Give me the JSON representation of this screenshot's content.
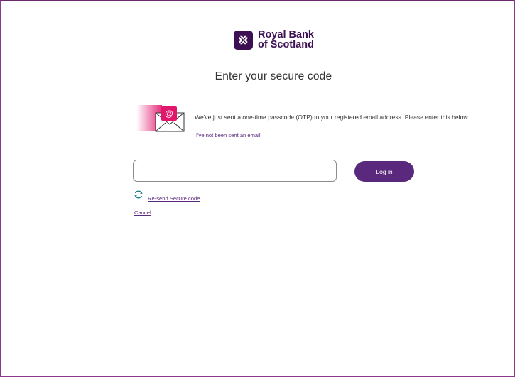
{
  "brand": {
    "line1": "Royal Bank",
    "line2": "of Scotland",
    "color": "#3c1053"
  },
  "page": {
    "title": "Enter your secure code"
  },
  "otp": {
    "message": "We've just sent a one-time passcode (OTP) to your registered email address. Please enter this below.",
    "no_email_link": "I've not been sent an email",
    "illustration_icon": "email-at-envelope-icon"
  },
  "form": {
    "code_value": "",
    "code_placeholder": "",
    "login_label": "Log in",
    "resend_label": "Re-send Secure code",
    "resend_icon": "refresh-icon",
    "cancel_label": "Cancel"
  },
  "colors": {
    "accent": "#5a287d",
    "pink": "#e2166c",
    "refresh": "#1d7b8a"
  }
}
